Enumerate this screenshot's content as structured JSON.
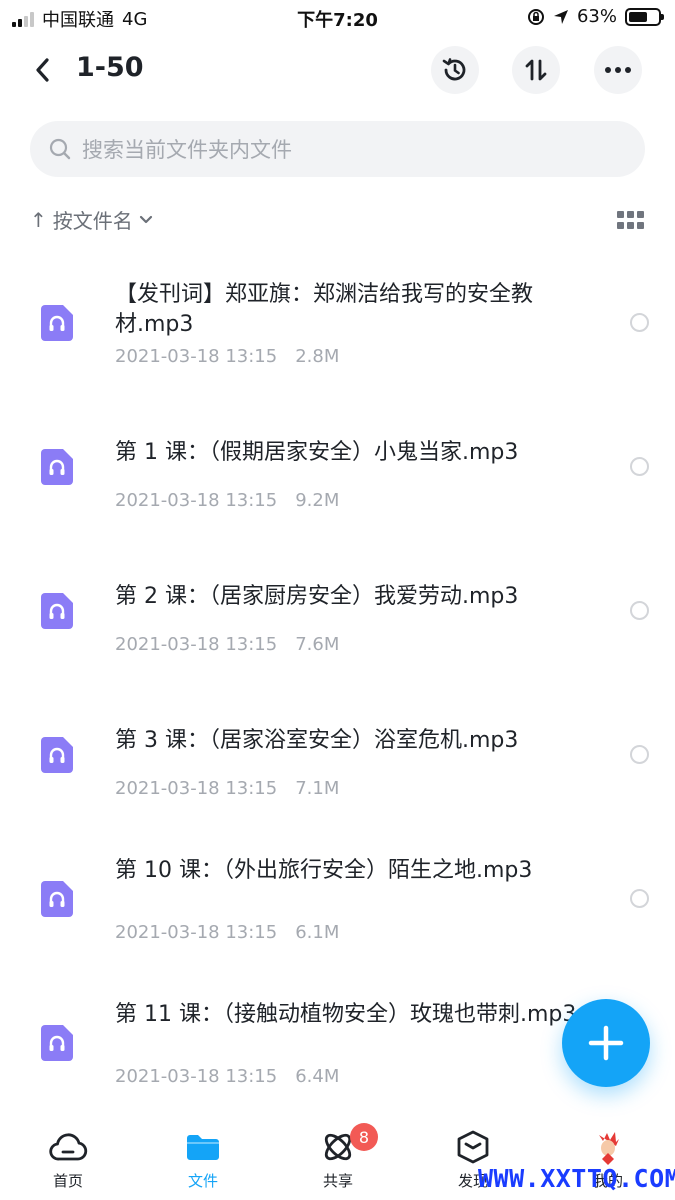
{
  "status_bar": {
    "carrier": "中国联通",
    "network": "4G",
    "time": "下午7:20",
    "battery": "63%",
    "battery_level": 0.63
  },
  "header": {
    "title": "1-50",
    "buttons": [
      "history-icon",
      "sort-icon",
      "more-icon"
    ]
  },
  "search": {
    "placeholder": "搜索当前文件夹内文件"
  },
  "sort": {
    "arrow": "↑",
    "label": "按文件名"
  },
  "files": [
    {
      "name": "【发刊词】郑亚旗：郑渊洁给我写的安全教材.mp3",
      "date": "2021-03-18 13:15",
      "size": "2.8M"
    },
    {
      "name": "第 1 课：（假期居家安全）小鬼当家.mp3",
      "date": "2021-03-18 13:15",
      "size": "9.2M"
    },
    {
      "name": "第 2 课：（居家厨房安全）我爱劳动.mp3",
      "date": "2021-03-18 13:15",
      "size": "7.6M"
    },
    {
      "name": "第 3 课：（居家浴室安全）浴室危机.mp3",
      "date": "2021-03-18 13:15",
      "size": "7.1M"
    },
    {
      "name": "第 10 课：（外出旅行安全）陌生之地.mp3",
      "date": "2021-03-18 13:15",
      "size": "6.1M"
    },
    {
      "name": "第 11 课：（接触动植物安全）玫瑰也带刺.mp3",
      "date": "2021-03-18 13:15",
      "size": "6.4M"
    }
  ],
  "nav": {
    "items": [
      {
        "label": "首页",
        "icon": "cloud-icon"
      },
      {
        "label": "文件",
        "icon": "folder-icon"
      },
      {
        "label": "共享",
        "icon": "orbit-icon"
      },
      {
        "label": "发现",
        "icon": "box-icon"
      },
      {
        "label": "我的",
        "icon": "avatar-icon"
      }
    ],
    "share_badge": "8"
  },
  "watermark": "WWW.XXTTQ.COM",
  "colors": {
    "accent": "#14a4f7",
    "audio_icon": "#8b7cf6",
    "badge": "#f25a55"
  }
}
